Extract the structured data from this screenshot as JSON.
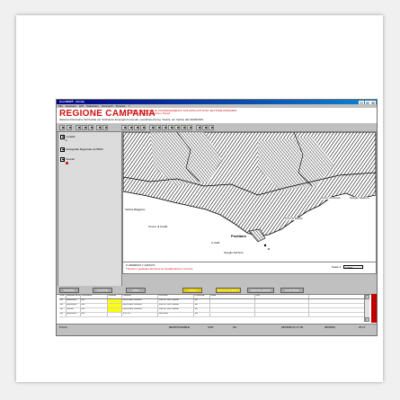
{
  "window": {
    "title": "GeoVIEW® - [Vista]"
  },
  "menu": [
    "File",
    "Gestione",
    "GIS",
    "Statistiche",
    "Strumenti",
    "Finestre",
    "?"
  ],
  "header": {
    "region": "REGIONE CAMPANIA",
    "sub_lines": [
      "AREA GENERALE DI COORDINAMENTO SVILUPPO ATTIVITA' SETTORE PRIMARIO",
      "Settore Foreste, Caccia e Pesca"
    ],
    "info_line": "Sistema Informativo Territoriale per Ordinanze Emergenza Incendi, coordinato da Ing. Trezza, ed. Vertice dal 01/05/2016"
  },
  "sidebar": {
    "layers": [
      {
        "label": "Località",
        "checked": true,
        "sub": "alt"
      },
      {
        "label": "Cartografia Regionale al 25000",
        "checked": true
      },
      {
        "label": "Incendi",
        "checked": true
      }
    ]
  },
  "map": {
    "labels": {
      "a": "Vettica Maggiore",
      "b": "Tovere di Amalfi",
      "c": "Positano",
      "d": "Pozzo d'Arienzo",
      "e": "Torre di Mezzo",
      "f": "Li Galli",
      "g": "Scoglio dell'Isca",
      "h": "Scoglio Vadituro"
    }
  },
  "coords": {
    "xy": "X 2450000.5    Y 4497272",
    "note": "Traccia in qualsiasi direzione la visualizzazione corrente",
    "scale_label": "Scala 1:",
    "scale_value": "10000"
  },
  "buttons": [
    "STAMPA",
    "FILATTE",
    "CREA",
    "LEGGI",
    "NUOVO EVENTO",
    "SEGNALAZIONI",
    "IN ATTESA"
  ],
  "table": {
    "headers": [
      "Cod",
      "Metodo Arrivo",
      "Operatore",
      "Gravita",
      "Località",
      "Comune",
      "Provincia",
      "Data",
      "Ora"
    ],
    "rows": [
      [
        "SA",
        "Elicottero",
        "BG",
        "",
        "ARIA DEL GRANO",
        "VIETRI SUL MARE",
        "SA",
        "",
        ""
      ],
      [
        "SA",
        "Elicottero",
        "BG",
        "",
        "ARIA DEL GRANO",
        "VIETRI SUL MARE",
        "SA",
        "",
        ""
      ],
      [
        "SA",
        "utente",
        "BG",
        "",
        "ARIA DEL GRANO",
        "VIETRI SUL MARE",
        "SA",
        "",
        ""
      ],
      [
        "SA",
        "Elicottero",
        "BG",
        "",
        "S.VITO",
        "CETARA",
        "SA",
        "",
        ""
      ]
    ]
  },
  "status": {
    "left": "Pronto",
    "role": "RESPONSABILE",
    "center": "COP",
    "prov": "SA",
    "datetime": "28/09/99 21:17:33",
    "date": "28/09/99",
    "time": "21:17"
  }
}
